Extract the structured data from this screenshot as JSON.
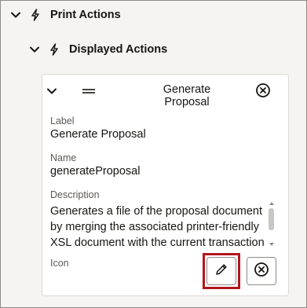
{
  "tree": {
    "level1_label": "Print Actions",
    "level2_label": "Displayed Actions"
  },
  "card": {
    "title": "Generate Proposal",
    "label_caption": "Label",
    "label_value": "Generate Proposal",
    "name_caption": "Name",
    "name_value": "generateProposal",
    "description_caption": "Description",
    "description_value": "Generates a file of the proposal document by merging the associated printer-friendly XSL document with the current transaction",
    "icon_caption": "Icon"
  },
  "colors": {
    "highlight": "#b3151d",
    "background": "#f5f4f2"
  },
  "icons": {
    "expand": "chevron-down-icon",
    "action": "lightning-bolt-icon",
    "drag": "drag-handle-icon",
    "remove": "close-circle-icon",
    "edit": "pencil-icon"
  }
}
